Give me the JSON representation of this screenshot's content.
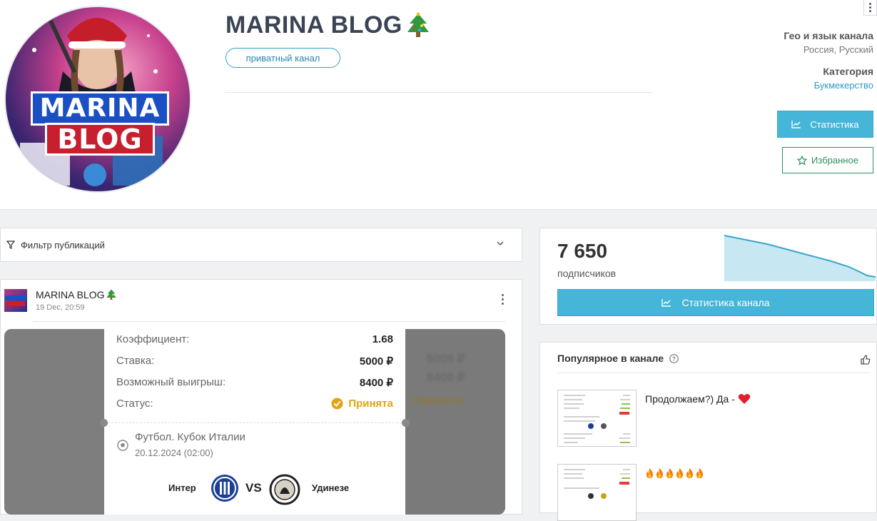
{
  "channel": {
    "title": "MARINA BLOG",
    "avatar_text_line1": "MARINA",
    "avatar_text_line2": "BLOG",
    "badge": "приватный канал"
  },
  "meta": {
    "geo_heading": "Гео и язык канала",
    "geo_value": "Россия, Русский",
    "category_heading": "Категория",
    "category_value": "Букмекерство"
  },
  "buttons": {
    "statistics": "Статистика",
    "favorites": "Избранное",
    "channel_statistics": "Статистика канала"
  },
  "filter": {
    "label": "Фильтр публикаций"
  },
  "post": {
    "author": "MARINA BLOG",
    "date": "19 Dec, 20:59",
    "ticket": {
      "coef_label": "Коэффициент:",
      "coef_value": "1.68",
      "stake_label": "Ставка:",
      "stake_value": "5000 ₽",
      "win_label": "Возможный выигрыш:",
      "win_value": "8400 ₽",
      "status_label": "Статус:",
      "status_value": "Принята",
      "league": "Футбол. Кубок Италии",
      "match_date": "20.12.2024 (02:00)",
      "team_home": "Интер",
      "vs": "VS",
      "team_away": "Удинезе"
    },
    "ghost_right": [
      "5000 ₽",
      "8400 ₽",
      "Принята"
    ]
  },
  "subscribers": {
    "count": "7 650",
    "label": "подписчиков"
  },
  "popular": {
    "title": "Популярное в канале",
    "items": [
      {
        "text": "Продолжаем?) Да -"
      },
      {
        "text": ""
      }
    ]
  },
  "colors": {
    "accent": "#45b5d8",
    "favorite": "#2f8f5e",
    "status_accepted": "#e0a514",
    "link": "#2b9ac7"
  }
}
